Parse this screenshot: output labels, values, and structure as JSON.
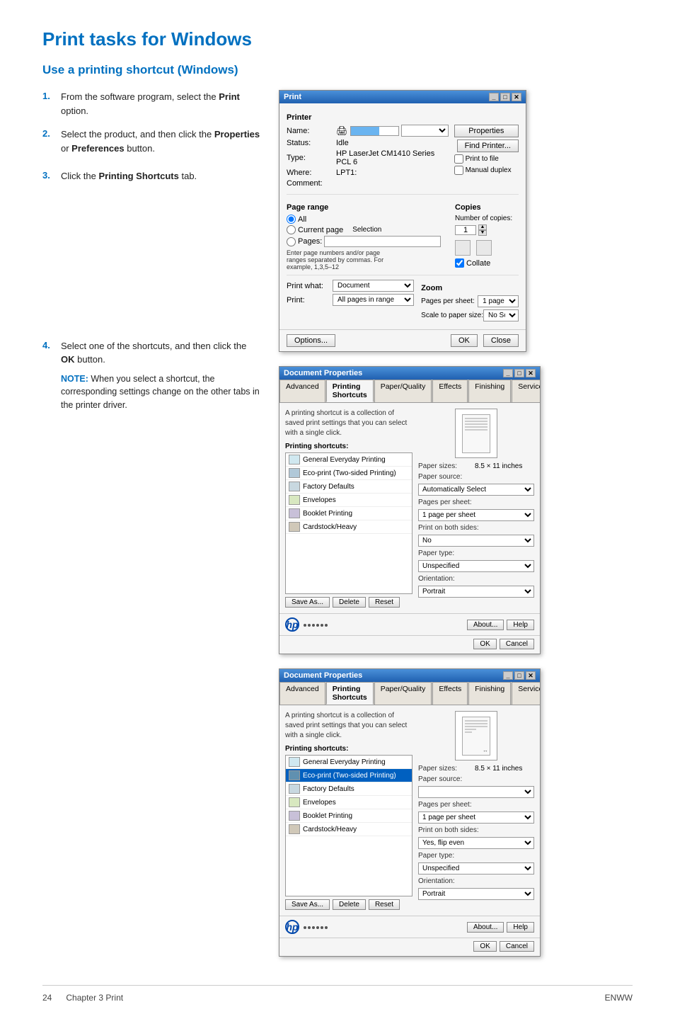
{
  "page": {
    "title": "Print tasks for Windows",
    "section_title": "Use a printing shortcut (Windows)"
  },
  "steps": [
    {
      "num": "1.",
      "text": "From the software program, select the ",
      "bold": "Print",
      "text2": " option."
    },
    {
      "num": "2.",
      "text": "Select the product, and then click the ",
      "bold": "Properties",
      "text2": " or ",
      "bold2": "Preferences",
      "text3": " button."
    },
    {
      "num": "3.",
      "text": "Click the ",
      "bold": "Printing Shortcuts",
      "text2": " tab."
    },
    {
      "num": "4.",
      "text": "Select one of the shortcuts, and then click the ",
      "bold": "OK",
      "text2": " button.",
      "note_label": "NOTE:",
      "note_text": "   When you select a shortcut, the corresponding settings change on the other tabs in the printer driver."
    }
  ],
  "print_dialog": {
    "title": "Print",
    "printer_section": "Printer",
    "name_label": "Name:",
    "status_label": "Status:",
    "status_val": "Idle",
    "type_label": "Type:",
    "type_val": "HP LaserJet CM1410 Series PCL 6",
    "where_label": "Where:",
    "where_val": "LPT1:",
    "comment_label": "Comment:",
    "properties_btn": "Properties",
    "find_printer_btn": "Find Printer...",
    "print_to_file": "Print to file",
    "manual_duplex": "Manual duplex",
    "page_range_section": "Page range",
    "all_radio": "All",
    "current_page_radio": "Current page",
    "selection_radio": "Selection",
    "pages_radio": "Pages:",
    "page_range_hint": "Enter page numbers and/or page ranges separated by commas. For example, 1,3,5–12",
    "copies_section": "Copies",
    "num_copies_label": "Number of copies:",
    "num_copies_val": "1",
    "collate_label": "Collate",
    "print_what_label": "Print what:",
    "print_what_val": "Document",
    "print_label": "Print:",
    "print_val": "All pages in range",
    "zoom_section": "Zoom",
    "pages_per_sheet_label": "Pages per sheet:",
    "pages_per_sheet_val": "1 page",
    "scale_label": "Scale to paper size:",
    "scale_val": "No Scaling",
    "options_btn": "Options...",
    "ok_btn": "OK",
    "close_btn": "Close"
  },
  "doc_props_dialog1": {
    "title": "Document Properties",
    "tabs": [
      "Advanced",
      "Printing Shortcuts",
      "Paper/Quality",
      "Effects",
      "Finishing",
      "Services"
    ],
    "active_tab": "Printing Shortcuts",
    "description": "A printing shortcut is a collection of saved print settings that you can select with a single click.",
    "shortcuts_label": "Printing shortcuts:",
    "shortcuts": [
      {
        "label": "General Everyday Printing",
        "selected": false
      },
      {
        "label": "Eco-print (Two-sided Printing)",
        "selected": false
      },
      {
        "label": "Factory Defaults",
        "selected": false
      },
      {
        "label": "Envelopes",
        "selected": false
      },
      {
        "label": "Booklet Printing",
        "selected": false
      },
      {
        "label": "Cardstock/Heavy",
        "selected": false
      }
    ],
    "paper_size_label": "Paper sizes:",
    "paper_size_val": "8.5 × 11 inches",
    "paper_source_label": "Paper source:",
    "paper_source_val": "Automatically Select",
    "pages_per_sheet_label": "Pages per sheet:",
    "pages_per_sheet_val": "1 page per sheet",
    "print_on_both_label": "Print on both sides:",
    "print_on_both_val": "No",
    "paper_type_label": "Paper type:",
    "paper_type_val": "Unspecified",
    "orientation_label": "Orientation:",
    "orientation_val": "Portrait",
    "save_as_btn": "Save As...",
    "delete_btn": "Delete",
    "reset_btn": "Reset",
    "about_btn": "About...",
    "help_btn": "Help",
    "ok_btn": "OK",
    "cancel_btn": "Cancel"
  },
  "doc_props_dialog2": {
    "title": "Document Properties",
    "tabs": [
      "Advanced",
      "Printing Shortcuts",
      "Paper/Quality",
      "Effects",
      "Finishing",
      "Services"
    ],
    "active_tab": "Printing Shortcuts",
    "description": "A printing shortcut is a collection of saved print settings that you can select with a single click.",
    "shortcuts_label": "Printing shortcuts:",
    "shortcuts": [
      {
        "label": "General Everyday Printing",
        "selected": false
      },
      {
        "label": "Eco-print (Two-sided Printing)",
        "selected": true
      },
      {
        "label": "Factory Defaults",
        "selected": false
      },
      {
        "label": "Envelopes",
        "selected": false
      },
      {
        "label": "Booklet Printing",
        "selected": false
      },
      {
        "label": "Cardstock/Heavy",
        "selected": false
      }
    ],
    "paper_size_label": "Paper sizes:",
    "paper_size_val": "8.5 × 11 inches",
    "paper_source_label": "Paper source:",
    "paper_source_val": "",
    "pages_per_sheet_label": "Pages per sheet:",
    "pages_per_sheet_val": "1 page per sheet",
    "print_on_both_label": "Print on both sides:",
    "print_on_both_val": "Yes, flip even",
    "paper_type_label": "Paper type:",
    "paper_type_val": "Unspecified",
    "orientation_label": "Orientation:",
    "orientation_val": "Portrait",
    "save_as_btn": "Save As...",
    "delete_btn": "Delete",
    "reset_btn": "Reset",
    "about_btn": "About...",
    "help_btn": "Help",
    "ok_btn": "OK",
    "cancel_btn": "Cancel"
  },
  "footer": {
    "page_num": "24",
    "chapter": "Chapter 3  Print",
    "brand": "ENWW"
  }
}
